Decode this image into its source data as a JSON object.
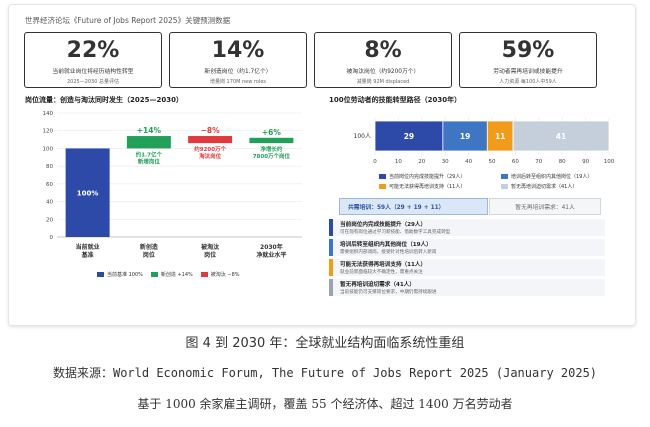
{
  "header": "世界经济论坛《Future of Jobs Report 2025》关键预测数据",
  "kpis": [
    {
      "big": "22%",
      "label": "当前就业岗位将经历结构性转型",
      "sub": "2025—2030 总量评估",
      "color": "#2f6fc0",
      "border": "#9dbde4",
      "bg": "#eef5fc"
    },
    {
      "big": "14%",
      "label": "新创造岗位（约1.7亿个）",
      "sub": "增量岗 170M new roles",
      "color": "#2f9a57",
      "border": "#98d2ad",
      "bg": "#eef9f2"
    },
    {
      "big": "8%",
      "label": "被淘汰岗位（约9200万个）",
      "sub": "减量岗 92M displaced",
      "color": "#d7383a",
      "border": "#eca3a4",
      "bg": "#fdf0f0"
    },
    {
      "big": "59%",
      "label": "劳动者需再培训或技能提升",
      "sub": "人力资源 每100人中59人",
      "color": "#e38612",
      "border": "#f0c487",
      "bg": "#fdf6ec"
    }
  ],
  "left_title": "岗位流量：创造与淘汰同时发生（2025—2030）",
  "right_title": "100位劳动者的技能转型路径（2030年）",
  "left_chart": {
    "type": "bar",
    "categories": [
      "当前就业\n基准",
      "新创造\n岗位",
      "被淘汰\n岗位",
      "2030年\n净就业水平"
    ],
    "yticks": [
      "0",
      "20",
      "40",
      "60",
      "80",
      "100",
      "120",
      "140"
    ],
    "ylim": [
      0,
      140
    ],
    "bars": [
      {
        "name": "当前基准 100%",
        "start": 0,
        "end": 100,
        "color": "#2e4aa8",
        "label": "100%",
        "note": ""
      },
      {
        "name": "新创造 +14%",
        "start": 100,
        "end": 114,
        "color": "#22a05a",
        "label": "+14%",
        "note": "约1.7亿个\n新增岗位"
      },
      {
        "name": "被淘汰 -8%",
        "start": 106,
        "end": 114,
        "color": "#e03a3c",
        "label": "−8%",
        "note": "约9200万个\n淘汰岗位"
      },
      {
        "name": "",
        "start": 106,
        "end": 112,
        "color": "#22a05a",
        "label": "+6%",
        "note": "净增长约\n7800万个岗位"
      }
    ],
    "legend": [
      {
        "label": "当前基准 100%",
        "color": "#2e4aa8"
      },
      {
        "label": "新创造 +14%",
        "color": "#22a05a"
      },
      {
        "label": "被淘汰 −8%",
        "color": "#e03a3c"
      }
    ]
  },
  "right_chart": {
    "type": "bar",
    "category": "100人",
    "xlim": [
      0,
      100
    ],
    "xticks": [
      "0",
      "10",
      "20",
      "30",
      "40",
      "50",
      "60",
      "70",
      "80",
      "90",
      "100"
    ],
    "segments": [
      {
        "name": "当前岗位内完成技能提升（29人）",
        "value": 29,
        "color": "#2e4aa8"
      },
      {
        "name": "培训后转至组织内其他岗位（19人）",
        "value": 19,
        "color": "#3f76c4"
      },
      {
        "name": "可能无法获得再培训支持（11人）",
        "value": 11,
        "color": "#f29a1a"
      },
      {
        "name": "暂无再培训迫切需求（41人）",
        "value": 41,
        "color": "#c4cfdb"
      }
    ]
  },
  "summary": {
    "left": "共需培训：59人（29 + 19 + 11）",
    "right": "暂无再培训需求：41人"
  },
  "reasons": [
    {
      "title": "当前岗位内完成技能提升（29人）",
      "desc": "可在现有岗位通过学习新技能、借助数字工具完成转型",
      "color": "#2e4aa8"
    },
    {
      "title": "培训后转至组织内其他岗位（19人）",
      "desc": "需要组织内部调岗，接受针对性培训后转入新岗",
      "color": "#3f76c4"
    },
    {
      "title": "可能无法获得再培训支持（11人）",
      "desc": "就业前景面临较大不确定性，需重点关注",
      "color": "#f29a1a"
    },
    {
      "title": "暂无再培训迫切需求（41人）",
      "desc": "当前技能仍可支撑岗位要求，中期仍需持续跟进",
      "color": "#9aa4ae"
    }
  ],
  "caption": {
    "line1": "图 4 到 2030 年：全球就业结构面临系统性重组",
    "line2": "数据来源：World Economic Forum, The Future of Jobs Report 2025 (January 2025)",
    "line3": "基于 1000 余家雇主调研，覆盖 55 个经济体、超过 1400 万名劳动者"
  }
}
